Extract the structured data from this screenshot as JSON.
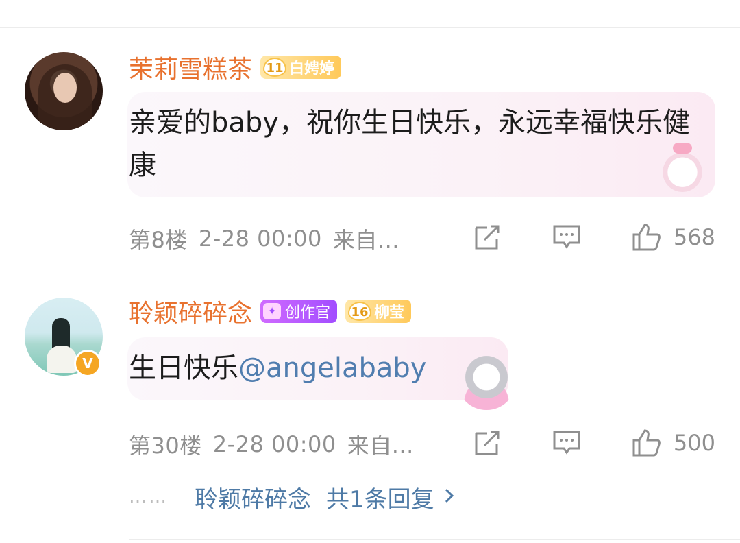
{
  "comments": [
    {
      "username": "茉莉雪糕茶",
      "level": "11",
      "fan_label": "白娉婷",
      "text": "亲爱的baby，祝你生日快乐，永远幸福快乐健康",
      "floor": "第8楼",
      "time": "2-28 00:00",
      "source": "来自...",
      "likes": "568",
      "avatar_icon": "user-avatar",
      "sticker_icon": "bunny-sticker"
    },
    {
      "username": "聆颖碎碎念",
      "creator_label": "创作官",
      "level": "16",
      "fan_label": "柳莹",
      "text_prefix": "生日快乐",
      "mention": "@angelababy",
      "floor": "第30楼",
      "time": "2-28 00:00",
      "source": "来自...",
      "likes": "500",
      "verified_badge": "V",
      "avatar_icon": "user-avatar",
      "sticker_icon": "cat-sticker"
    }
  ],
  "reply_preview": {
    "dots": "……",
    "name": "聆颖碎碎念",
    "count_text": "共1条回复",
    "chevron_icon": "chevron-right-icon"
  },
  "colors": {
    "username": "#e8722f",
    "mention": "#507daf",
    "meta": "#8f8f8f",
    "level_badge": "#ffc95a",
    "creator_badge": "#a24dff"
  }
}
